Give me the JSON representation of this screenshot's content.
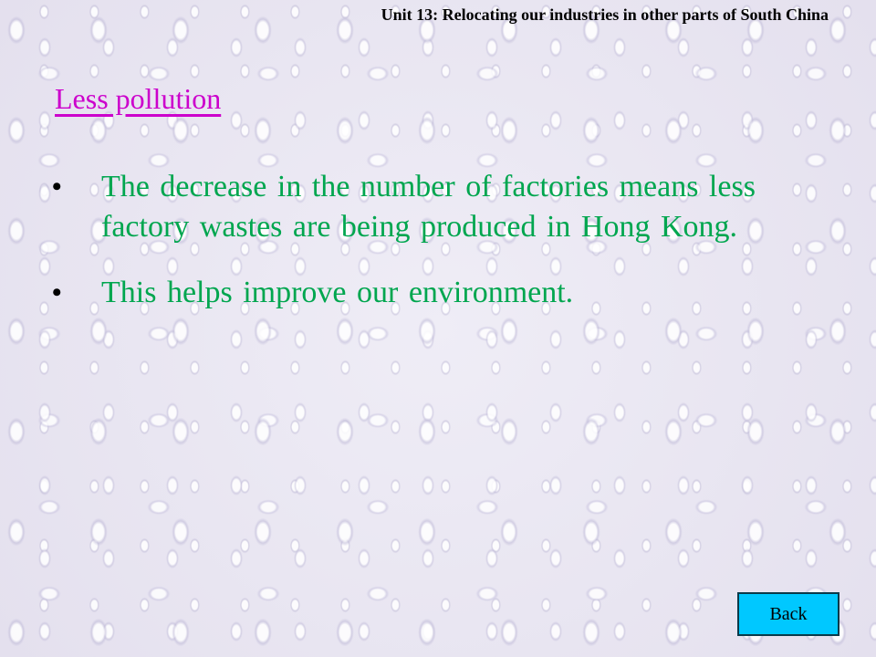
{
  "header": {
    "unit_title": "Unit 13: Relocating our industries in other parts of South China"
  },
  "section": {
    "heading": "Less pollution",
    "bullets": [
      {
        "marker": "•",
        "text": "The decrease in the number of factories means less factory wastes are being produced in Hong Kong."
      },
      {
        "marker": "•",
        "text": "This helps improve our environment."
      }
    ]
  },
  "navigation": {
    "back_label": "Back"
  },
  "colors": {
    "heading": "#cc00cc",
    "bullet_text": "#00a64f",
    "back_button": "#00c8ff"
  }
}
